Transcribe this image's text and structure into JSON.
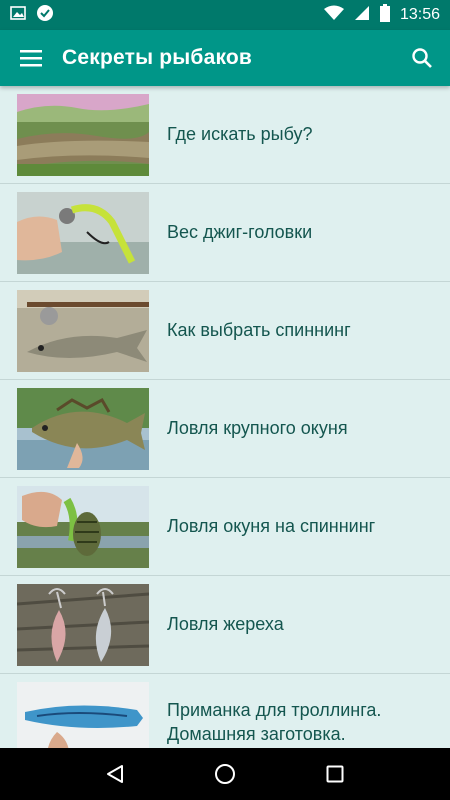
{
  "status_bar": {
    "time": "13:56",
    "left_icons": [
      "image-icon",
      "check-badge-icon"
    ],
    "right_icons": [
      "wifi-icon",
      "signal-icon",
      "battery-icon"
    ]
  },
  "app_bar": {
    "title": "Секреты рыбаков",
    "menu_icon": "hamburger-menu-icon",
    "search_icon": "search-icon",
    "color": "#009688",
    "status_color": "#00796b"
  },
  "articles": [
    {
      "title": "Где искать рыбу?",
      "thumb": "river-photo"
    },
    {
      "title": "Вес джиг-головки",
      "thumb": "jig-head-photo"
    },
    {
      "title": "Как выбрать спиннинг",
      "thumb": "spinning-rod-photo"
    },
    {
      "title": "Ловля крупного окуня",
      "thumb": "perch-photo"
    },
    {
      "title": "Ловля окуня на спиннинг",
      "thumb": "perch-spinning-photo"
    },
    {
      "title": "Ловля жереха",
      "thumb": "spoon-lures-photo"
    },
    {
      "title": "Приманка для троллинга. Домашняя заготовка.",
      "thumb": "trolling-lure-photo"
    }
  ],
  "nav_bar": {
    "back_icon": "back-triangle-icon",
    "home_icon": "home-circle-icon",
    "recents_icon": "recents-square-icon"
  }
}
